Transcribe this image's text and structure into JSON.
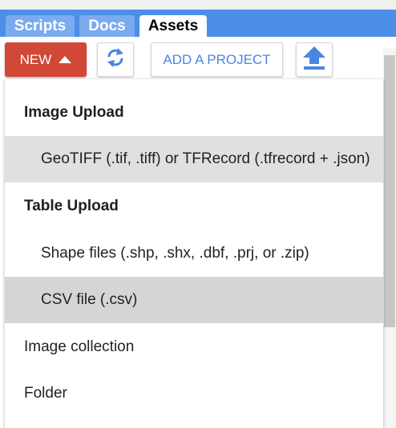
{
  "tabs": [
    {
      "label": "Scripts",
      "active": false
    },
    {
      "label": "Docs",
      "active": false
    },
    {
      "label": "Assets",
      "active": true
    }
  ],
  "toolbar": {
    "new_label": "NEW",
    "refresh_icon": "refresh-icon",
    "add_project_label": "ADD A PROJECT",
    "upload_icon": "upload-icon"
  },
  "menu": {
    "image_upload_header": "Image Upload",
    "image_upload_item": "GeoTIFF (.tif, .tiff) or TFRecord (.tfrecord + .json)",
    "table_upload_header": "Table Upload",
    "shape_files_item": "Shape files (.shp, .shx, .dbf, .prj, or .zip)",
    "csv_item": "CSV file (.csv)",
    "image_collection_item": "Image collection",
    "folder_item": "Folder"
  },
  "colors": {
    "tabbar": "#4c8ee8",
    "new_button": "#d14836",
    "accent_blue": "#4a86e0"
  }
}
